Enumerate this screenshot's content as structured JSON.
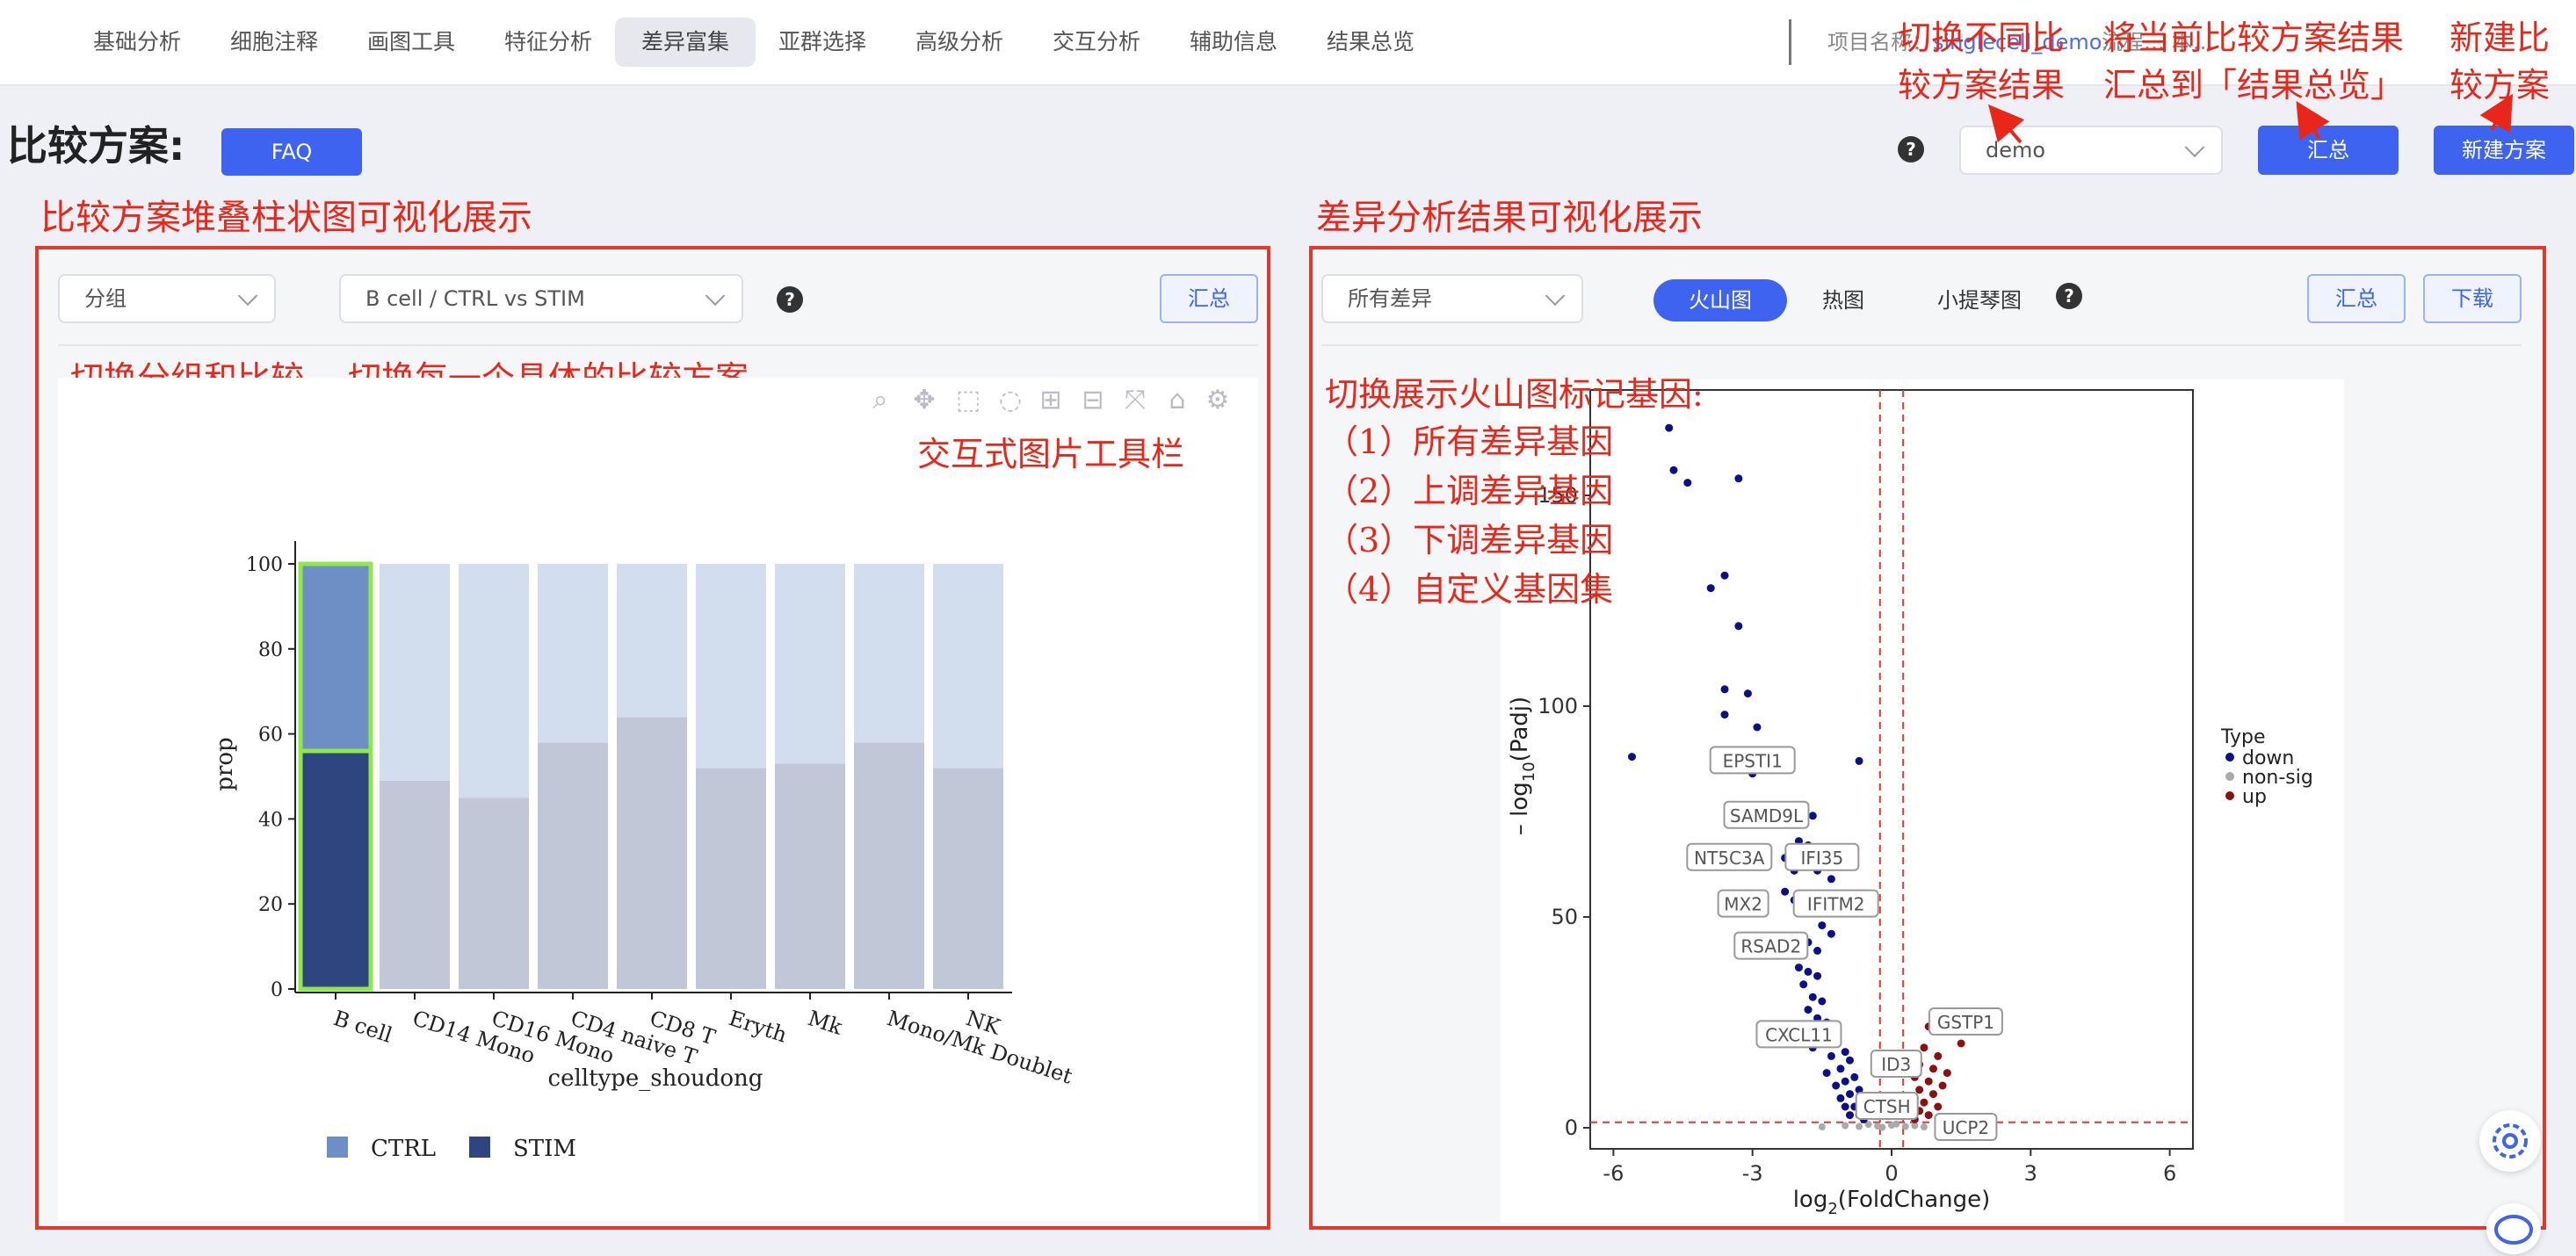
{
  "nav": {
    "items": [
      {
        "label": "基础分析",
        "x": 76
      },
      {
        "label": "细胞注释",
        "x": 232
      },
      {
        "label": "画图工具",
        "x": 388
      },
      {
        "label": "特征分析",
        "x": 544
      },
      {
        "label": "差异富集",
        "x": 700,
        "active": true
      },
      {
        "label": "亚群选择",
        "x": 856
      },
      {
        "label": "高级分析",
        "x": 1012
      },
      {
        "label": "交互分析",
        "x": 1168
      },
      {
        "label": "辅助信息",
        "x": 1324
      },
      {
        "label": "结果总览",
        "x": 1480
      }
    ],
    "project_label": "项目名称：",
    "project_name": "singlecell_demo...",
    "extra_label": "流程…       本…"
  },
  "header": {
    "title": "比较方案:",
    "faq": "FAQ",
    "scheme_select": "demo",
    "summary_button": "汇总",
    "new_scheme_button": "新建方案"
  },
  "annotations": {
    "switch_scheme_1": "切换不同比",
    "switch_scheme_2": "较方案结果",
    "summarize_1": "将当前比较方案结果",
    "summarize_2": "汇总到「结果总览」",
    "new_1": "新建比",
    "new_2": "较方案",
    "left_panel": "比较方案堆叠柱状图可视化展示",
    "right_panel": "差异分析结果可视化展示",
    "switch_group": "切换分组和比较",
    "switch_each": "切换每一个具体的比较方案",
    "toolbar": "交互式图片工具栏",
    "volcano_title": "切换展示火山图标记基因:",
    "volcano_1": "（1）所有差异基因",
    "volcano_2": "（2）上调差异基因",
    "volcano_3": "（3）下调差异基因",
    "volcano_4": "（4）自定义基因集"
  },
  "left": {
    "group_select": "分组",
    "compare_select": "B cell / CTRL vs STIM",
    "summary_button": "汇总"
  },
  "right": {
    "diff_select": "所有差异",
    "tabs": [
      "火山图",
      "热图",
      "小提琴图"
    ],
    "summary_button": "汇总",
    "download_button": "下载"
  },
  "colors": {
    "primary": "#3e63f0",
    "annotation": "#e8271a",
    "ctrl_selected": "#6e8fc6",
    "stim_selected": "#2e4580",
    "ctrl": "#d2ddee",
    "stim": "#c2c7d8",
    "down": "#0b0f8a",
    "up": "#8b1010",
    "nonsig": "#aaaaaa"
  },
  "chart_data": [
    {
      "type": "bar",
      "stacked": true,
      "categories": [
        "B cell",
        "CD14 Mono",
        "CD16 Mono",
        "CD4 naive T",
        "CD8 T",
        "Eryth",
        "Mk",
        "Mono/Mk Doublet",
        "NK"
      ],
      "series": [
        {
          "name": "STIM",
          "values": [
            56,
            49,
            45,
            58,
            64,
            52,
            53,
            58,
            52
          ]
        },
        {
          "name": "CTRL",
          "values": [
            44,
            51,
            55,
            42,
            36,
            48,
            47,
            42,
            48
          ]
        }
      ],
      "xlabel": "celltype_shoudong",
      "ylabel": "prop",
      "ylim": [
        0,
        100
      ],
      "yticks": [
        "0",
        "20",
        "40",
        "60",
        "80",
        "100"
      ],
      "selected": "B cell",
      "legend": [
        "CTRL",
        "STIM"
      ]
    },
    {
      "type": "scatter",
      "xlabel_pre": "log",
      "xlabel_sub": "2",
      "xlabel_post": "(FoldChange)",
      "ylabel_pre": "– log",
      "ylabel_sub": "10",
      "ylabel_post": "(Padj)",
      "xlim": [
        -6.5,
        6.5
      ],
      "ylim": [
        -5,
        175
      ],
      "xticks": [
        "-6",
        "-3",
        "0",
        "3",
        "6"
      ],
      "yticks": [
        "0",
        "50",
        "100",
        "150"
      ],
      "legend_title": "Type",
      "legend": [
        "down",
        "non-sig",
        "up"
      ],
      "vlines": [
        -0.25,
        0.25
      ],
      "hline": 1.3,
      "points_down": [
        [
          -4.8,
          166
        ],
        [
          -4.7,
          156
        ],
        [
          -4.4,
          153
        ],
        [
          -3.3,
          154
        ],
        [
          -3.9,
          128
        ],
        [
          -3.6,
          131
        ],
        [
          -3.3,
          119
        ],
        [
          -3.6,
          104
        ],
        [
          -3.1,
          103
        ],
        [
          -3.6,
          98
        ],
        [
          -2.9,
          95
        ],
        [
          -5.6,
          88
        ],
        [
          -2.5,
          88
        ],
        [
          -0.7,
          87
        ],
        [
          -3.0,
          84
        ],
        [
          -2.6,
          75
        ],
        [
          -1.7,
          74
        ],
        [
          -2.0,
          68
        ],
        [
          -1.8,
          67
        ],
        [
          -2.3,
          64
        ],
        [
          -2.1,
          61
        ],
        [
          -1.6,
          61
        ],
        [
          -1.3,
          59
        ],
        [
          -2.3,
          56
        ],
        [
          -2.1,
          54
        ],
        [
          -1.9,
          52
        ],
        [
          -1.5,
          48
        ],
        [
          -1.3,
          46
        ],
        [
          -1.8,
          44
        ],
        [
          -1.6,
          42
        ],
        [
          -2.0,
          38
        ],
        [
          -1.8,
          37
        ],
        [
          -1.6,
          36
        ],
        [
          -1.9,
          34
        ],
        [
          -1.7,
          31
        ],
        [
          -1.5,
          30
        ],
        [
          -1.8,
          28
        ],
        [
          -1.6,
          26
        ],
        [
          -1.4,
          25
        ],
        [
          -1.9,
          23
        ],
        [
          -1.2,
          22
        ],
        [
          -1.5,
          20
        ],
        [
          -1.7,
          19
        ],
        [
          -1.0,
          18
        ],
        [
          -1.3,
          17
        ],
        [
          -0.9,
          16
        ],
        [
          -1.1,
          14
        ],
        [
          -1.4,
          13
        ],
        [
          -0.8,
          12
        ],
        [
          -1.0,
          11
        ],
        [
          -1.2,
          10
        ],
        [
          -0.7,
          9
        ],
        [
          -0.9,
          8
        ],
        [
          -1.1,
          7
        ],
        [
          -0.6,
          6
        ],
        [
          -0.8,
          5
        ],
        [
          -1.0,
          5
        ],
        [
          -0.5,
          4
        ],
        [
          -0.7,
          3
        ],
        [
          -0.9,
          3
        ],
        [
          -0.6,
          2
        ]
      ],
      "points_up": [
        [
          0.9,
          27
        ],
        [
          1.2,
          26
        ],
        [
          0.8,
          24
        ],
        [
          1.5,
          20
        ],
        [
          0.7,
          19
        ],
        [
          1.0,
          17
        ],
        [
          0.6,
          15
        ],
        [
          0.9,
          14
        ],
        [
          1.2,
          13
        ],
        [
          0.5,
          12
        ],
        [
          0.8,
          11
        ],
        [
          1.1,
          10
        ],
        [
          0.6,
          9
        ],
        [
          0.9,
          8
        ],
        [
          0.5,
          7
        ],
        [
          0.7,
          6
        ],
        [
          1.0,
          5
        ],
        [
          0.6,
          4
        ],
        [
          0.8,
          3
        ],
        [
          0.5,
          2
        ]
      ],
      "points_nonsig": [
        [
          -1.5,
          0.2
        ],
        [
          -1.0,
          0.5
        ],
        [
          -0.7,
          0.3
        ],
        [
          -0.5,
          0.8
        ],
        [
          -0.3,
          0.4
        ],
        [
          0,
          0.6
        ],
        [
          0.3,
          0.3
        ],
        [
          0.5,
          0.5
        ],
        [
          0.7,
          0.2
        ],
        [
          1.0,
          0.4
        ],
        [
          1.2,
          0.6
        ],
        [
          -0.2,
          0.1
        ],
        [
          0.1,
          0.9
        ]
      ],
      "labels": [
        {
          "text": "EPSTI1",
          "x": -3.0,
          "y": 87
        },
        {
          "text": "SAMD9L",
          "x": -2.7,
          "y": 74
        },
        {
          "text": "NT5C3A",
          "x": -3.5,
          "y": 64
        },
        {
          "text": "IFI35",
          "x": -1.5,
          "y": 64
        },
        {
          "text": "MX2",
          "x": -3.2,
          "y": 53
        },
        {
          "text": "IFITM2",
          "x": -1.2,
          "y": 53
        },
        {
          "text": "RSAD2",
          "x": -2.6,
          "y": 43
        },
        {
          "text": "GSTP1",
          "x": 1.6,
          "y": 25
        },
        {
          "text": "CXCL11",
          "x": -2.0,
          "y": 22
        },
        {
          "text": "ID3",
          "x": 0.1,
          "y": 15
        },
        {
          "text": "CTSH",
          "x": -0.1,
          "y": 5
        },
        {
          "text": "UCP2",
          "x": 1.6,
          "y": 0
        }
      ]
    }
  ]
}
